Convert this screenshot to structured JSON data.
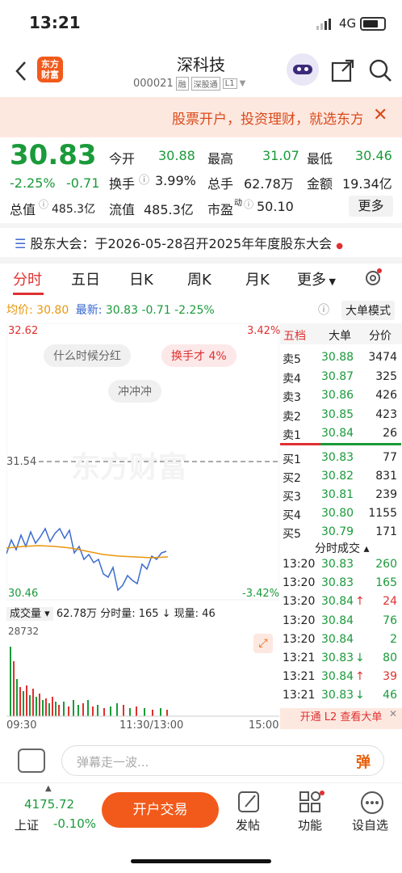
{
  "status": {
    "time": "13:21",
    "network": "4G"
  },
  "header": {
    "title": "深科技",
    "code": "000021",
    "tags": [
      "融",
      "深股通",
      "L1"
    ],
    "logo_text": "东方\n财富"
  },
  "banner": {
    "text": "股票开户，投资理财，就选东方财富"
  },
  "quote": {
    "price": "30.83",
    "change_pct": "-2.25%",
    "change": "-0.71",
    "open_label": "今开",
    "open": "30.88",
    "high_label": "最高",
    "high": "31.07",
    "low_label": "最低",
    "low": "30.46",
    "turnover_label": "换手",
    "turnover": "3.99%",
    "volume_label": "总手",
    "volume": "62.78万",
    "amount_label": "金额",
    "amount": "19.34亿",
    "mktcap_label": "总值",
    "mktcap": "485.3亿",
    "float_label": "流值",
    "float": "485.3亿",
    "pe_label": "市盈",
    "pe_sup": "动",
    "pe": "50.10",
    "more": "更多"
  },
  "notice": {
    "label": "股东大会：",
    "text": "于2026-05-28召开2025年年度股东大会"
  },
  "tabs": [
    "分时",
    "五日",
    "日K",
    "周K",
    "月K",
    "更多"
  ],
  "chart": {
    "avg_label": "均价:",
    "avg": "30.80",
    "latest_label": "最新:",
    "latest": "30.83",
    "chg": "-0.71",
    "pct": "-2.25%",
    "bigorder": "大单模式",
    "y_high": "32.62",
    "y_low": "30.46",
    "pct_high": "3.42%",
    "pct_low": "-3.42%",
    "prev_close": "31.54",
    "bubbles": [
      "什么时候分红",
      "换手才 4%",
      "冲冲冲"
    ],
    "watermark": "东方财富",
    "vol_label": "成交量",
    "vol_total": "62.78万",
    "vol_info": "分时量: 165 ↓ 现量: 46",
    "vol_max": "28732",
    "time_labels": [
      "09:30",
      "11:30/13:00",
      "15:00"
    ]
  },
  "book": {
    "tabs": [
      "五档",
      "大单",
      "分价"
    ],
    "sells": [
      [
        "卖5",
        "30.88",
        "3474"
      ],
      [
        "卖4",
        "30.87",
        "325"
      ],
      [
        "卖3",
        "30.86",
        "426"
      ],
      [
        "卖2",
        "30.85",
        "423"
      ],
      [
        "卖1",
        "30.84",
        "26"
      ]
    ],
    "buys": [
      [
        "买1",
        "30.83",
        "77"
      ],
      [
        "买2",
        "30.82",
        "831"
      ],
      [
        "买3",
        "30.81",
        "239"
      ],
      [
        "买4",
        "30.80",
        "1155"
      ],
      [
        "买5",
        "30.79",
        "171"
      ]
    ],
    "trades_title": "分时成交",
    "trades": [
      [
        "13:20",
        "30.83",
        "",
        "260"
      ],
      [
        "13:20",
        "30.83",
        "",
        "165"
      ],
      [
        "13:20",
        "30.84",
        "↑",
        "24"
      ],
      [
        "13:20",
        "30.84",
        "",
        "76"
      ],
      [
        "13:20",
        "30.84",
        "",
        "2"
      ],
      [
        "13:21",
        "30.83",
        "↓",
        "80"
      ],
      [
        "13:21",
        "30.84",
        "↑",
        "39"
      ],
      [
        "13:21",
        "30.83",
        "↓",
        "46"
      ]
    ],
    "l2": "开通 L2 查看大单"
  },
  "danmu": {
    "placeholder": "弹幕走一波...",
    "icon": "弹"
  },
  "bottom": {
    "index_value": "4175.72",
    "index_name": "上证",
    "index_pct": "-0.10%",
    "trade": "开户交易",
    "post": "发帖",
    "func": "功能",
    "custom": "设自选"
  }
}
